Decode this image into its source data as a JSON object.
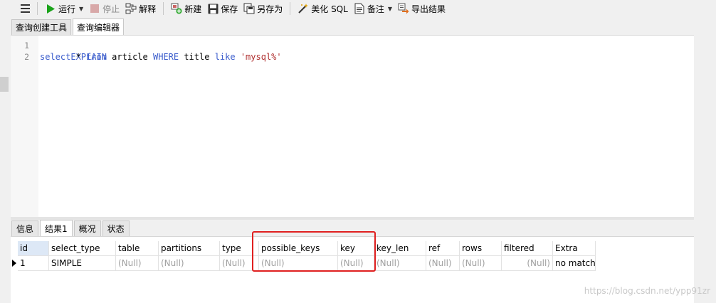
{
  "toolbar": {
    "run_label": "运行",
    "stop_label": "停止",
    "explain_label": "解释",
    "new_label": "新建",
    "save_label": "保存",
    "saveas_label": "另存为",
    "beautify_label": "美化 SQL",
    "note_label": "备注",
    "export_label": "导出结果"
  },
  "editor_tabs": [
    "查询创建工具",
    "查询编辑器"
  ],
  "editor": {
    "lines": [
      {
        "num": "1"
      },
      {
        "num": "2"
      }
    ],
    "line1": {
      "kw": "EXPLAIN"
    },
    "line2": {
      "t1": "select",
      "t2": " * ",
      "t3": "from",
      "t4": " article ",
      "t5": "WHERE",
      "t6": " title ",
      "t7": "like",
      "t8": " ",
      "t9": "'mysql%'"
    }
  },
  "result_tabs": [
    "信息",
    "结果1",
    "概况",
    "状态"
  ],
  "grid": {
    "columns": [
      "id",
      "select_type",
      "table",
      "partitions",
      "type",
      "possible_keys",
      "key",
      "key_len",
      "ref",
      "rows",
      "filtered",
      "Extra"
    ],
    "row": [
      "1",
      "SIMPLE",
      "(Null)",
      "(Null)",
      "(Null)",
      "(Null)",
      "(Null)",
      "(Null)",
      "(Null)",
      "(Null)",
      "(Null)",
      "no matchi"
    ]
  },
  "watermark": "https://blog.csdn.net/ypp91zr",
  "colors": {
    "keyword": "#3a5ccc",
    "string": "#b03030",
    "highlight": "#e02020",
    "run_icon": "#1aa31a"
  }
}
